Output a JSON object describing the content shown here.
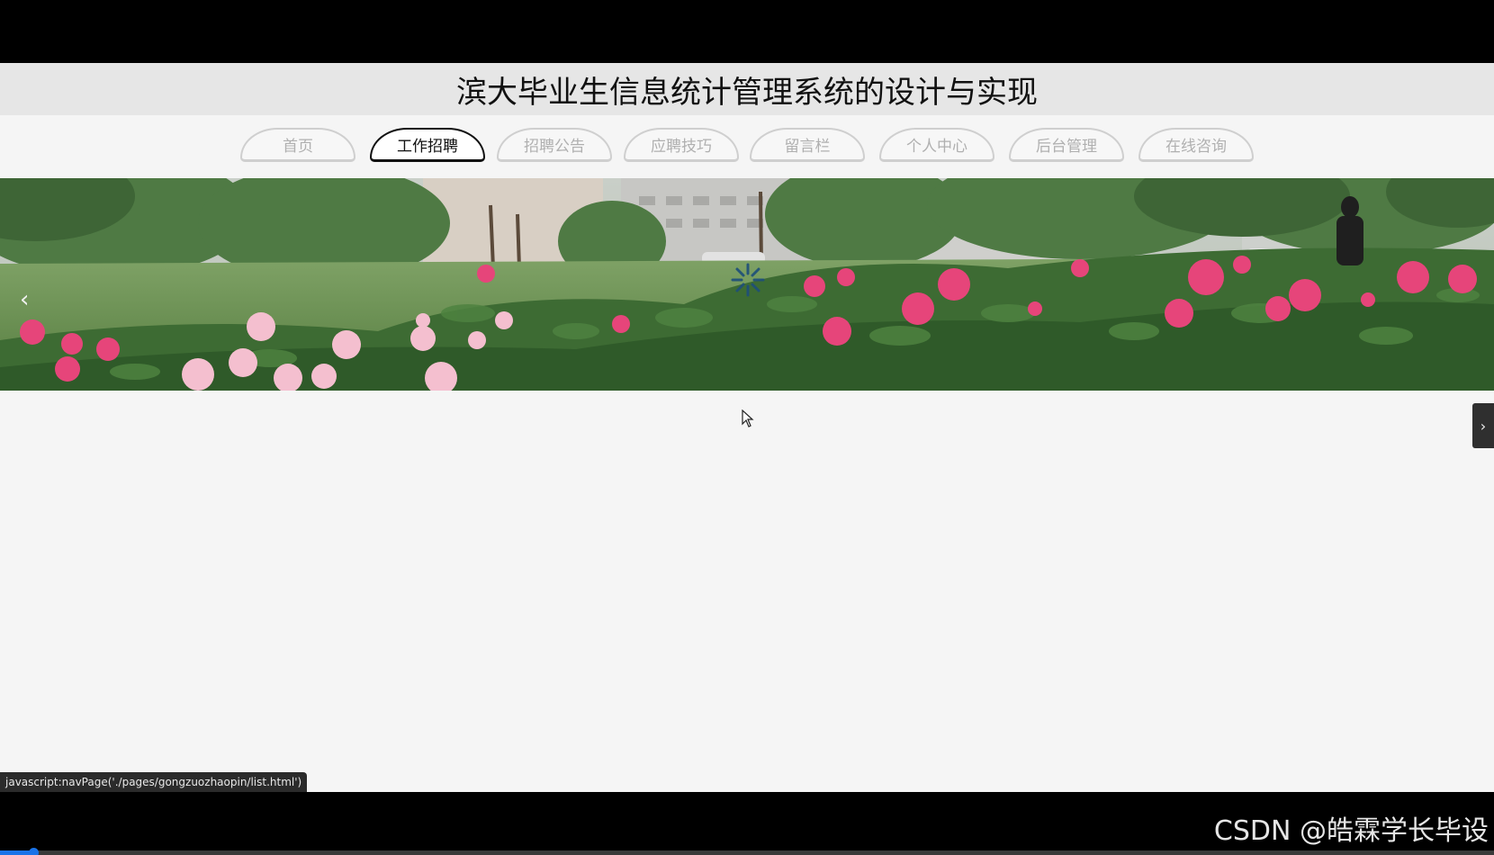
{
  "header": {
    "title": "滨大毕业生信息统计管理系统的设计与实现"
  },
  "nav": {
    "items": [
      {
        "label": "首页",
        "active": false
      },
      {
        "label": "工作招聘",
        "active": true
      },
      {
        "label": "招聘公告",
        "active": false
      },
      {
        "label": "应聘技巧",
        "active": false
      },
      {
        "label": "留言栏",
        "active": false
      },
      {
        "label": "个人中心",
        "active": false
      },
      {
        "label": "后台管理",
        "active": false
      },
      {
        "label": "在线咨询",
        "active": false
      }
    ]
  },
  "banner": {
    "prev_icon": "chevron-left-icon",
    "prev_glyph": "‹",
    "loading_icon": "spinner-icon"
  },
  "side_panel": {
    "toggle_icon": "chevron-right-icon",
    "toggle_glyph": "›"
  },
  "status_bar": {
    "text": "javascript:navPage('./pages/gongzuozhaopin/list.html')"
  },
  "watermark": {
    "text": "CSDN @皓霖学长毕设"
  },
  "video": {
    "progress": 0.022
  },
  "colors": {
    "active_border": "#111111",
    "inactive_text": "#b0b0b0",
    "progress": "#1a73e8"
  }
}
